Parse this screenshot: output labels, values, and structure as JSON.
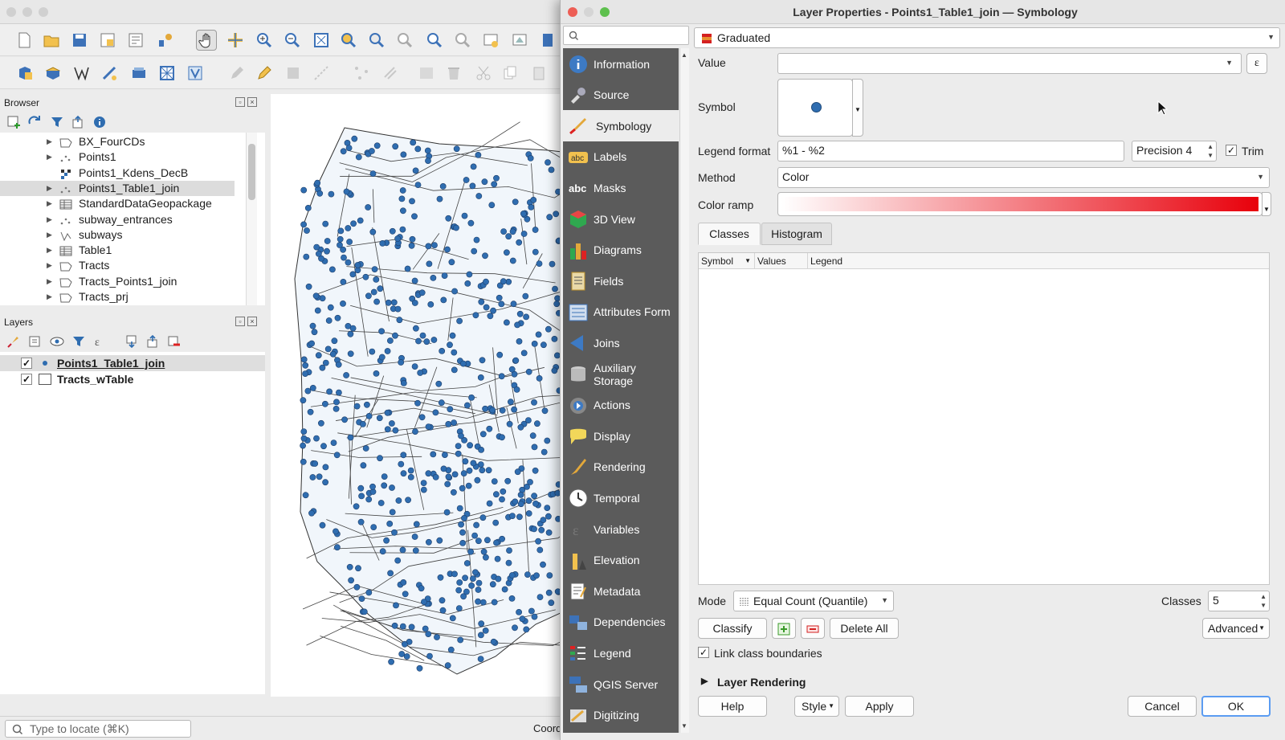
{
  "qgis": {
    "browser": {
      "title": "Browser",
      "items": [
        {
          "label": "BX_FourCDs",
          "type": "polygon",
          "selected": false
        },
        {
          "label": "Points1",
          "type": "point",
          "selected": false
        },
        {
          "label": "Points1_Kdens_DecB",
          "type": "raster",
          "selected": false
        },
        {
          "label": "Points1_Table1_join",
          "type": "point",
          "selected": true
        },
        {
          "label": "StandardDataGeopackage",
          "type": "table",
          "selected": false
        },
        {
          "label": "subway_entrances",
          "type": "point",
          "selected": false
        },
        {
          "label": "subways",
          "type": "line",
          "selected": false
        },
        {
          "label": "Table1",
          "type": "table",
          "selected": false
        },
        {
          "label": "Tracts",
          "type": "polygon",
          "selected": false
        },
        {
          "label": "Tracts_Points1_join",
          "type": "polygon",
          "selected": false
        },
        {
          "label": "Tracts_prj",
          "type": "polygon",
          "selected": false
        }
      ]
    },
    "layers": {
      "title": "Layers",
      "items": [
        {
          "label": "Points1_Table1_join",
          "checked": true,
          "underline": true
        },
        {
          "label": "Tracts_wTable",
          "checked": true,
          "underline": false
        }
      ]
    },
    "locate_placeholder": "Type to locate (⌘K)",
    "status_coord_label": "Coord"
  },
  "dialog": {
    "title": "Layer Properties - Points1_Table1_join — Symbology",
    "sidebar": [
      {
        "label": "Information",
        "icon": "info-icon"
      },
      {
        "label": "Source",
        "icon": "source-icon"
      },
      {
        "label": "Symbology",
        "icon": "symbology-icon",
        "active": true
      },
      {
        "label": "Labels",
        "icon": "labels-icon"
      },
      {
        "label": "Masks",
        "icon": "masks-icon"
      },
      {
        "label": "3D View",
        "icon": "cube-icon"
      },
      {
        "label": "Diagrams",
        "icon": "diagrams-icon"
      },
      {
        "label": "Fields",
        "icon": "fields-icon"
      },
      {
        "label": "Attributes Form",
        "icon": "form-icon"
      },
      {
        "label": "Joins",
        "icon": "joins-icon"
      },
      {
        "label": "Auxiliary Storage",
        "icon": "database-icon"
      },
      {
        "label": "Actions",
        "icon": "actions-icon"
      },
      {
        "label": "Display",
        "icon": "display-icon"
      },
      {
        "label": "Rendering",
        "icon": "rendering-icon"
      },
      {
        "label": "Temporal",
        "icon": "clock-icon"
      },
      {
        "label": "Variables",
        "icon": "variables-icon"
      },
      {
        "label": "Elevation",
        "icon": "elevation-icon"
      },
      {
        "label": "Metadata",
        "icon": "metadata-icon"
      },
      {
        "label": "Dependencies",
        "icon": "dependencies-icon"
      },
      {
        "label": "Legend",
        "icon": "legend-icon"
      },
      {
        "label": "QGIS Server",
        "icon": "server-icon"
      },
      {
        "label": "Digitizing",
        "icon": "digitizing-icon"
      }
    ],
    "renderer": "Graduated",
    "value_label": "Value",
    "value": "",
    "symbol_label": "Symbol",
    "legend_format_label": "Legend format",
    "legend_format": "%1 - %2",
    "precision": "Precision 4",
    "trim_label": "Trim",
    "trim_checked": true,
    "method_label": "Method",
    "method": "Color",
    "color_ramp_label": "Color ramp",
    "color_ramp": {
      "start": "#ffffff",
      "end": "#e8000b"
    },
    "tabs": [
      "Classes",
      "Histogram"
    ],
    "table_headers": [
      "Symbol",
      "Values",
      "Legend"
    ],
    "mode_label": "Mode",
    "mode": "Equal Count (Quantile)",
    "classes_label": "Classes",
    "classes": "5",
    "classify_btn": "Classify",
    "delete_all_btn": "Delete All",
    "advanced_btn": "Advanced",
    "link_class_label": "Link class boundaries",
    "link_class_checked": true,
    "layer_rendering_label": "Layer Rendering",
    "help_btn": "Help",
    "style_btn": "Style",
    "apply_btn": "Apply",
    "cancel_btn": "Cancel",
    "ok_btn": "OK"
  },
  "colors": {
    "point_fill": "#2f6db0",
    "tract_fill": "#f1f6fb",
    "sidebar_bg": "#5b5b5b",
    "accent": "#5b9cf2"
  }
}
